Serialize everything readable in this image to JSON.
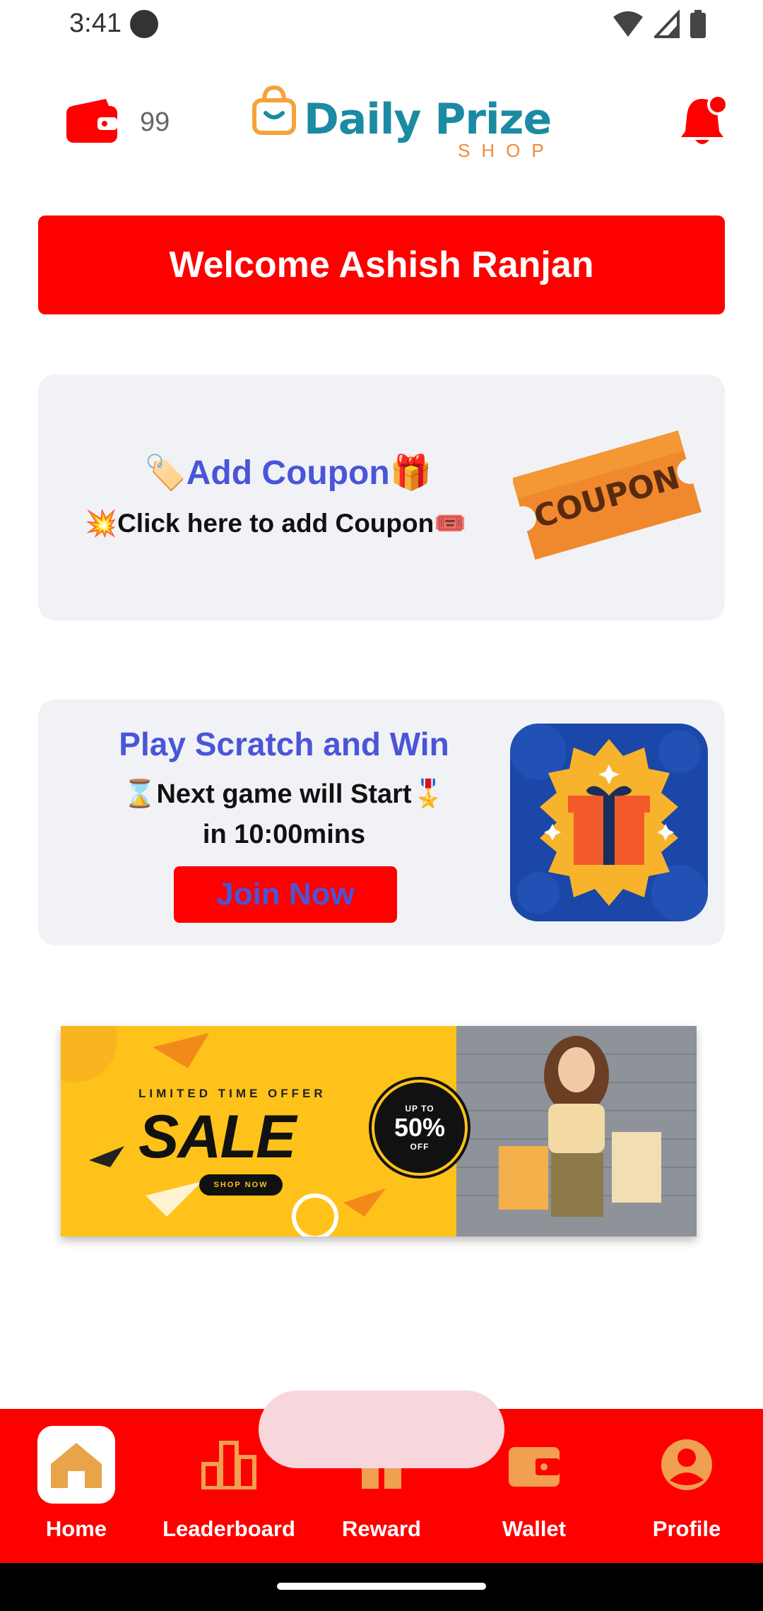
{
  "status_bar": {
    "time": "3:41",
    "icons": [
      "record-dot-icon",
      "wifi-icon",
      "signal-icon",
      "battery-icon"
    ]
  },
  "header": {
    "wallet_count": "99",
    "logo_title": "Daily Prize",
    "logo_subtitle": "SHOP",
    "icons": [
      "wallet-icon",
      "shopping-bag-icon",
      "bell-icon"
    ]
  },
  "welcome": {
    "text": "Welcome Ashish Ranjan"
  },
  "coupon_card": {
    "title_prefix": "🏷️",
    "title": "Add Coupon",
    "title_suffix": "🎁",
    "subtitle_prefix": "💥",
    "subtitle": "Click here to add Coupon",
    "subtitle_suffix": "🎟️",
    "ticket_text": "COUPON"
  },
  "scratch_card": {
    "title": "Play Scratch and Win",
    "line1_prefix": "⌛",
    "line1": "Next game will Start",
    "line1_suffix": "🎖️",
    "line2": "in 10:00mins",
    "join_label": "Join Now"
  },
  "sale_banner": {
    "limited": "LIMITED TIME OFFER",
    "sale": "SALE",
    "shop_now": "SHOP NOW",
    "up_to": "UP TO",
    "percent": "50%",
    "off": "OFF"
  },
  "bottom_nav": {
    "items": [
      {
        "label": "Home",
        "icon": "home-icon",
        "active": true
      },
      {
        "label": "Leaderboard",
        "icon": "bar-chart-icon",
        "active": false
      },
      {
        "label": "Reward",
        "icon": "gift-icon",
        "active": false
      },
      {
        "label": "Wallet",
        "icon": "wallet-icon",
        "active": false
      },
      {
        "label": "Profile",
        "icon": "profile-icon",
        "active": false
      }
    ]
  },
  "colors": {
    "brand_red": "#fe0000",
    "accent_blue": "#4a55d8",
    "icon_orange": "#f0a050",
    "card_bg": "#f1f2f6"
  }
}
